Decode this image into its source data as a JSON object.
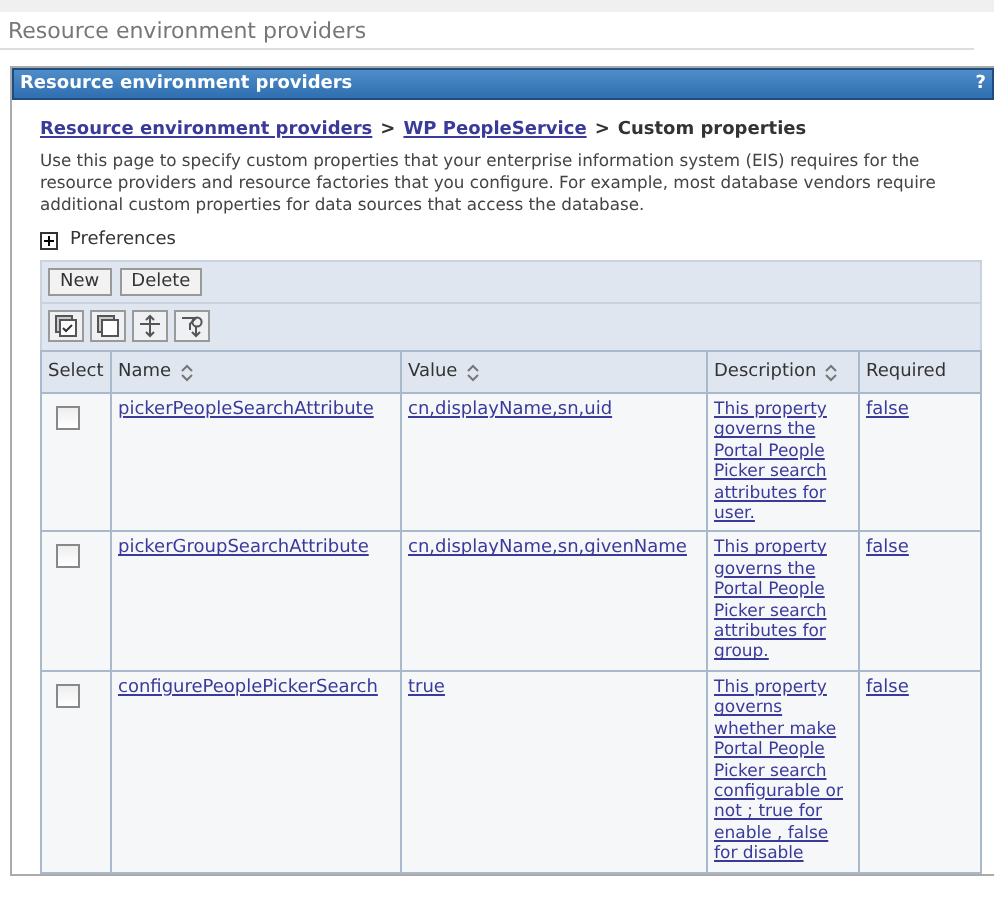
{
  "page_title": "Resource environment providers",
  "panel": {
    "title": "Resource environment providers",
    "help": "?"
  },
  "breadcrumb": [
    {
      "label": "Resource environment providers",
      "kind": "link"
    },
    {
      "label": "WP PeopleService",
      "kind": "link"
    },
    {
      "label": "Custom properties",
      "kind": "current"
    }
  ],
  "separator": ">",
  "intro": "Use this page to specify custom properties that your enterprise information system (EIS) requires for the resource providers and resource factories that you configure. For example, most database vendors require additional custom properties for data sources that access the database.",
  "preferences": {
    "label": "Preferences",
    "expanded": false
  },
  "buttons": [
    "New",
    "Delete"
  ],
  "table": {
    "columns": [
      {
        "label": "Select",
        "sortable": false
      },
      {
        "label": "Name",
        "sortable": true
      },
      {
        "label": "Value",
        "sortable": true
      },
      {
        "label": "Description",
        "sortable": true
      },
      {
        "label": "Required",
        "sortable": false
      }
    ],
    "rows": [
      {
        "checked": false,
        "name": "pickerPeopleSearchAttribute",
        "value": "cn,displayName,sn,uid",
        "description": "This property governs the Portal People Picker search attributes for user.",
        "required": "false"
      },
      {
        "checked": false,
        "name": "pickerGroupSearchAttribute",
        "value": "cn,displayName,sn,givenName",
        "description": "This property governs the Portal People Picker search attributes for group.",
        "required": "false"
      },
      {
        "checked": false,
        "name": "configurePeoplePickerSearch",
        "value": "true",
        "description": "This property governs whether make Portal People Picker search configurable or not ; true for enable , false for disable",
        "required": "false"
      }
    ]
  }
}
